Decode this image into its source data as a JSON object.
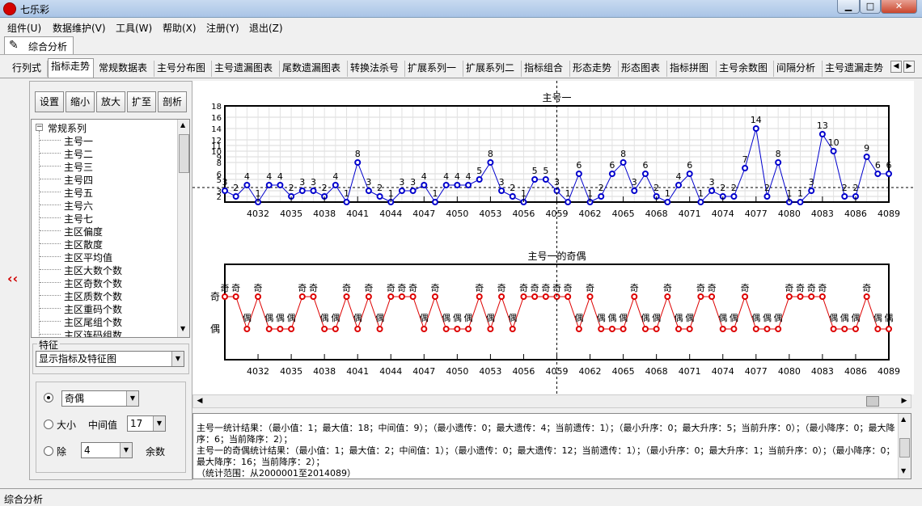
{
  "window": {
    "title": "七乐彩"
  },
  "menu": [
    "组件(U)",
    "数据维护(V)",
    "工具(W)",
    "帮助(X)",
    "注册(Y)",
    "退出(Z)"
  ],
  "doc_tab": "综合分析",
  "tabs": [
    "行列式",
    "指标走势",
    "常规数据表",
    "主号分布图",
    "主号遗漏图表",
    "尾数遗漏图表",
    "转换法杀号",
    "扩展系列一",
    "扩展系列二",
    "指标组合",
    "形态走势",
    "形态图表",
    "指标拼图",
    "主号余数图",
    "间隔分析",
    "主号遗漏走势"
  ],
  "active_tab": 1,
  "toolbar": {
    "set": "设置",
    "shrink": "缩小",
    "enlarge": "放大",
    "expand": "扩至",
    "analyze": "剖析"
  },
  "collapse_label": "‹‹",
  "tree": {
    "root": "常规系列",
    "expander": "−",
    "items": [
      "主号一",
      "主号二",
      "主号三",
      "主号四",
      "主号五",
      "主号六",
      "主号七",
      "主区偏度",
      "主区散度",
      "主区平均值",
      "主区大数个数",
      "主区奇数个数",
      "主区质数个数",
      "主区重码个数",
      "主区尾组个数",
      "主区连码组数"
    ]
  },
  "feature": {
    "title": "特征",
    "mode": "显示指标及特征图"
  },
  "options": {
    "parity_value": "奇偶",
    "size_label": "大小",
    "median_label": "中间值",
    "median_value": "17",
    "div_label": "除",
    "div_value": "4",
    "remainder_label": "余数"
  },
  "stats_text": "主号一统计结果：（最小值：1；最大值：18；中间值：9）；（最小遗传：0；最大遗传：4；当前遗传：1）；（最小升序：0；最大升序：5；当前升序：0）；（最小降序：0；最大降序：6；当前降序：2）；\n主号一的奇偶统计结果：（最小值：1；最大值：2；中间值：1）；（最小遗传：0；最大遗传：12；当前遗传：1）；（最小升序：0；最大升序：1；当前升序：0）；（最小降序：0；最大降序：16；当前降序：2）；\n（统计范围：从2000001至2014089）",
  "status": "综合分析",
  "chart_data": [
    {
      "type": "line",
      "title": "主号一",
      "x_start": 4029,
      "x_end": 4089,
      "x_ticks": [
        4032,
        4035,
        4038,
        4041,
        4044,
        4047,
        4050,
        4053,
        4056,
        4059,
        4062,
        4065,
        4068,
        4071,
        4074,
        4077,
        4080,
        4083,
        4086,
        4089
      ],
      "y_ticks": [
        2,
        3,
        5,
        6,
        8,
        9,
        10,
        11,
        12,
        14,
        16,
        18
      ],
      "ylim": [
        1,
        18
      ],
      "values": [
        3,
        2,
        4,
        1,
        4,
        4,
        2,
        3,
        3,
        2,
        4,
        1,
        8,
        3,
        2,
        1,
        3,
        3,
        4,
        1,
        4,
        4,
        4,
        5,
        8,
        3,
        2,
        1,
        5,
        5,
        3,
        1,
        6,
        1,
        2,
        6,
        8,
        3,
        6,
        2,
        1,
        4,
        6,
        1,
        3,
        2,
        2,
        7,
        14,
        2,
        8,
        1,
        1,
        3,
        13,
        10,
        2,
        2,
        9,
        6,
        6
      ],
      "series_color": "#0000cc"
    },
    {
      "type": "line",
      "title": "主号一的奇偶",
      "x_start": 4029,
      "x_end": 4089,
      "x_ticks": [
        4032,
        4035,
        4038,
        4041,
        4044,
        4047,
        4050,
        4053,
        4056,
        4059,
        4062,
        4065,
        4068,
        4071,
        4074,
        4077,
        4080,
        4083,
        4086,
        4089
      ],
      "categories": [
        "奇",
        "偶"
      ],
      "values": [
        "奇",
        "奇",
        "偶",
        "奇",
        "偶",
        "偶",
        "偶",
        "奇",
        "奇",
        "偶",
        "偶",
        "奇",
        "偶",
        "奇",
        "偶",
        "奇",
        "奇",
        "奇",
        "偶",
        "奇",
        "偶",
        "偶",
        "偶",
        "奇",
        "偶",
        "奇",
        "偶",
        "奇",
        "奇",
        "奇",
        "奇",
        "奇",
        "偶",
        "奇",
        "偶",
        "偶",
        "偶",
        "奇",
        "偶",
        "偶",
        "奇",
        "偶",
        "偶",
        "奇",
        "奇",
        "偶",
        "偶",
        "奇",
        "偶",
        "偶",
        "偶",
        "奇",
        "奇",
        "奇",
        "奇",
        "偶",
        "偶",
        "偶",
        "奇",
        "偶",
        "偶"
      ],
      "series_color": "#dd0000"
    }
  ]
}
